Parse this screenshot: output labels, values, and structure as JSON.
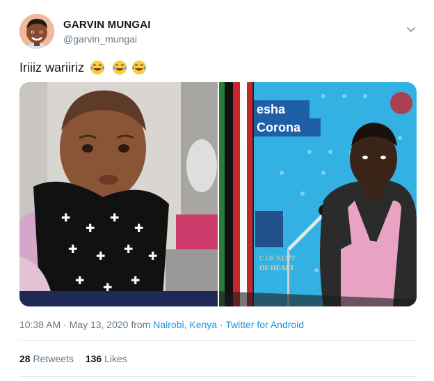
{
  "author": {
    "display_name": "GARVIN MUNGAI",
    "handle": "@garvin_mungai"
  },
  "tweet": {
    "text": "Iriiiz wariiriz",
    "emojis": [
      "face-with-tears-of-joy",
      "face-with-tears-of-joy",
      "face-with-tears-of-joy"
    ]
  },
  "media": {
    "sign_line1": "esha",
    "sign_line2": "Corona",
    "podium_line1": "C OF KENY",
    "podium_line2": "OF HEALT"
  },
  "meta": {
    "time": "10:38 AM",
    "date": "May 13, 2020",
    "from_label": "from",
    "location": "Nairobi, Kenya",
    "source": "Twitter for Android",
    "sep1": " · ",
    "sep2": " · "
  },
  "stats": {
    "retweets_count": "28",
    "retweets_label": "Retweets",
    "likes_count": "136",
    "likes_label": "Likes"
  },
  "colors": {
    "text": "#14171a",
    "secondary": "#657786",
    "link": "#1b95e0",
    "divider": "#e6ecf0",
    "backdrop_blue": "#33b1e3"
  }
}
